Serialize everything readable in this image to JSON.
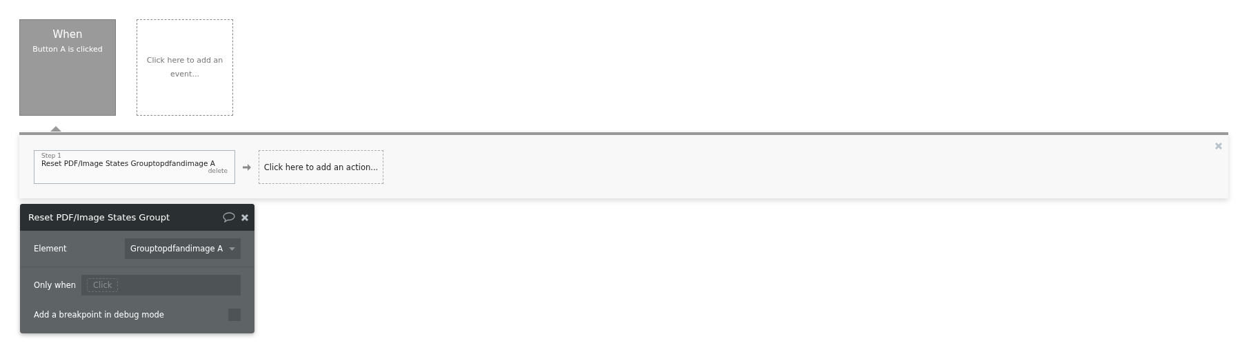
{
  "events": [
    {
      "kind": "event",
      "title": "When",
      "subtitle": "Button A is clicked",
      "selected": true
    },
    {
      "kind": "add",
      "label": "Click here to add an event..."
    }
  ],
  "workflow": {
    "steps": [
      {
        "step_label": "Step 1",
        "name": "Reset PDF/Image States Grouptopdfandimage A",
        "delete": "delete"
      }
    ],
    "add_action": "Click here to add an action..."
  },
  "properties": {
    "title": "Reset PDF/Image States Groupt",
    "element_label": "Element",
    "element_value": "Grouptopdfandimage A",
    "only_when_label": "Only when",
    "only_when_placeholder": "Click",
    "breakpoint_label": "Add a breakpoint in debug mode",
    "breakpoint_checked": false
  }
}
